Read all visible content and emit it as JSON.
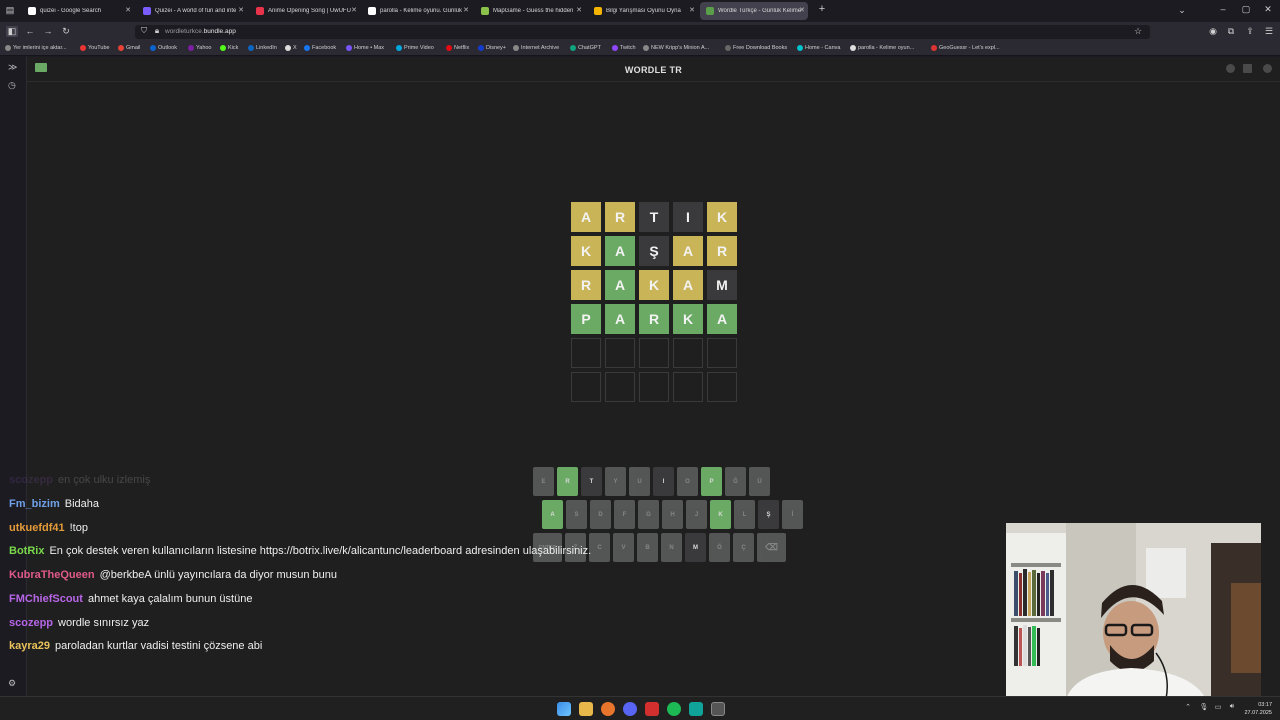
{
  "tabs": [
    {
      "label": "quizei - Google Search",
      "color": "#ffffff",
      "active": false
    },
    {
      "label": "Quizei - A world of fun and inte",
      "color": "#7a5cff",
      "active": false
    },
    {
      "label": "Anime Opening Song | UwUFU",
      "color": "#e8334a",
      "active": false
    },
    {
      "label": "parolla - Kelime oyunu. Günlük",
      "color": "#ffffff",
      "active": false
    },
    {
      "label": "MapGame - Guess the hidden",
      "color": "#8bc34a",
      "active": false
    },
    {
      "label": "Bilgi Yarışması Oyunu Oyna",
      "color": "#f5b400",
      "active": false
    },
    {
      "label": "Wordle Türkçe - Günlük Kelime",
      "color": "#5a9e4a",
      "active": true
    }
  ],
  "url": {
    "prefix": "wordleturkce.",
    "domain": "bundle.app"
  },
  "bookmarks": [
    "Yer imlerini içe aktar...",
    "YouTube",
    "Gmail",
    "Outlook",
    "Yahoo",
    "Kick",
    "LinkedIn",
    "X",
    "Facebook",
    "Home • Max",
    "Prime Video",
    "Netflix",
    "Disney+",
    "Internet Archive",
    "ChatGPT",
    "Twitch",
    "NEW Kripp's Minion A...",
    "Free Download Books",
    "Home - Canva",
    "parolla - Kelime oyun...",
    "GeoGuessr - Let's expl..."
  ],
  "game": {
    "title": "WORDLE TR"
  },
  "colors": {
    "yellow": "#c9b458",
    "green": "#6aaa64",
    "gray": "#3a3a3c",
    "keybase": "#818384"
  },
  "board": [
    [
      {
        "l": "A",
        "s": "present"
      },
      {
        "l": "R",
        "s": "present"
      },
      {
        "l": "T",
        "s": "absent"
      },
      {
        "l": "I",
        "s": "absent"
      },
      {
        "l": "K",
        "s": "present"
      }
    ],
    [
      {
        "l": "K",
        "s": "present"
      },
      {
        "l": "A",
        "s": "correct"
      },
      {
        "l": "Ş",
        "s": "absent"
      },
      {
        "l": "A",
        "s": "present"
      },
      {
        "l": "R",
        "s": "present"
      }
    ],
    [
      {
        "l": "R",
        "s": "present"
      },
      {
        "l": "A",
        "s": "correct"
      },
      {
        "l": "K",
        "s": "present"
      },
      {
        "l": "A",
        "s": "present"
      },
      {
        "l": "M",
        "s": "absent"
      }
    ],
    [
      {
        "l": "P",
        "s": "correct"
      },
      {
        "l": "A",
        "s": "correct"
      },
      {
        "l": "R",
        "s": "correct"
      },
      {
        "l": "K",
        "s": "correct"
      },
      {
        "l": "A",
        "s": "correct"
      }
    ],
    [
      {
        "l": "",
        "s": "empty"
      },
      {
        "l": "",
        "s": "empty"
      },
      {
        "l": "",
        "s": "empty"
      },
      {
        "l": "",
        "s": "empty"
      },
      {
        "l": "",
        "s": "empty"
      }
    ],
    [
      {
        "l": "",
        "s": "empty"
      },
      {
        "l": "",
        "s": "empty"
      },
      {
        "l": "",
        "s": "empty"
      },
      {
        "l": "",
        "s": "empty"
      },
      {
        "l": "",
        "s": "empty"
      }
    ]
  ],
  "keyboard": [
    [
      {
        "k": "E",
        "s": "unused"
      },
      {
        "k": "R",
        "s": "correct"
      },
      {
        "k": "T",
        "s": "absent"
      },
      {
        "k": "Y",
        "s": "unused"
      },
      {
        "k": "U",
        "s": "unused"
      },
      {
        "k": "I",
        "s": "absent"
      },
      {
        "k": "O",
        "s": "unused"
      },
      {
        "k": "P",
        "s": "correct"
      },
      {
        "k": "Ğ",
        "s": "unused"
      },
      {
        "k": "Ü",
        "s": "unused"
      }
    ],
    [
      {
        "k": "A",
        "s": "correct"
      },
      {
        "k": "S",
        "s": "unused"
      },
      {
        "k": "D",
        "s": "unused"
      },
      {
        "k": "F",
        "s": "unused"
      },
      {
        "k": "G",
        "s": "unused"
      },
      {
        "k": "H",
        "s": "unused"
      },
      {
        "k": "J",
        "s": "unused"
      },
      {
        "k": "K",
        "s": "correct"
      },
      {
        "k": "L",
        "s": "unused"
      },
      {
        "k": "Ş",
        "s": "absent"
      },
      {
        "k": "İ",
        "s": "unused"
      }
    ],
    [
      {
        "k": "ENTER",
        "s": "unused"
      },
      {
        "k": "Z",
        "s": "unused"
      },
      {
        "k": "C",
        "s": "unused"
      },
      {
        "k": "V",
        "s": "unused"
      },
      {
        "k": "B",
        "s": "unused"
      },
      {
        "k": "N",
        "s": "unused"
      },
      {
        "k": "M",
        "s": "absent"
      },
      {
        "k": "Ö",
        "s": "unused"
      },
      {
        "k": "Ç",
        "s": "unused"
      },
      {
        "k": "⌫",
        "s": "unused"
      }
    ]
  ],
  "chat": [
    {
      "user": "scozepp",
      "text": "en çok ulku izlemiş",
      "color": "#9a58c8",
      "faded": true
    },
    {
      "user": "Fm_bizim",
      "text": "Bidaha",
      "color": "#6fa0e8"
    },
    {
      "user": "utkuefdf41",
      "text": "!top",
      "color": "#e59b3a"
    },
    {
      "user": "BotRix",
      "text": "En çok destek veren kullanıcıların listesine https://botrix.live/k/alicantunc/leaderboard adresinden ulaşabilirsiniz.",
      "color": "#79d94a"
    },
    {
      "user": "KubraTheQueen",
      "text": "@berkbeA ünlü yayıncılara da diyor musun bunu",
      "color": "#e05a8a"
    },
    {
      "user": "FMChiefScout",
      "text": "ahmet kaya çalalım bunun üstüne",
      "color": "#b866e8"
    },
    {
      "user": "scozepp",
      "text": "wordle sınırsız yaz",
      "color": "#b866e8"
    },
    {
      "user": "kayra29",
      "text": "paroladan kurtlar vadisi testini çözsene abi",
      "color": "#e8c25a"
    }
  ],
  "clock": {
    "time": "03:17",
    "date": "27.07.2025"
  }
}
